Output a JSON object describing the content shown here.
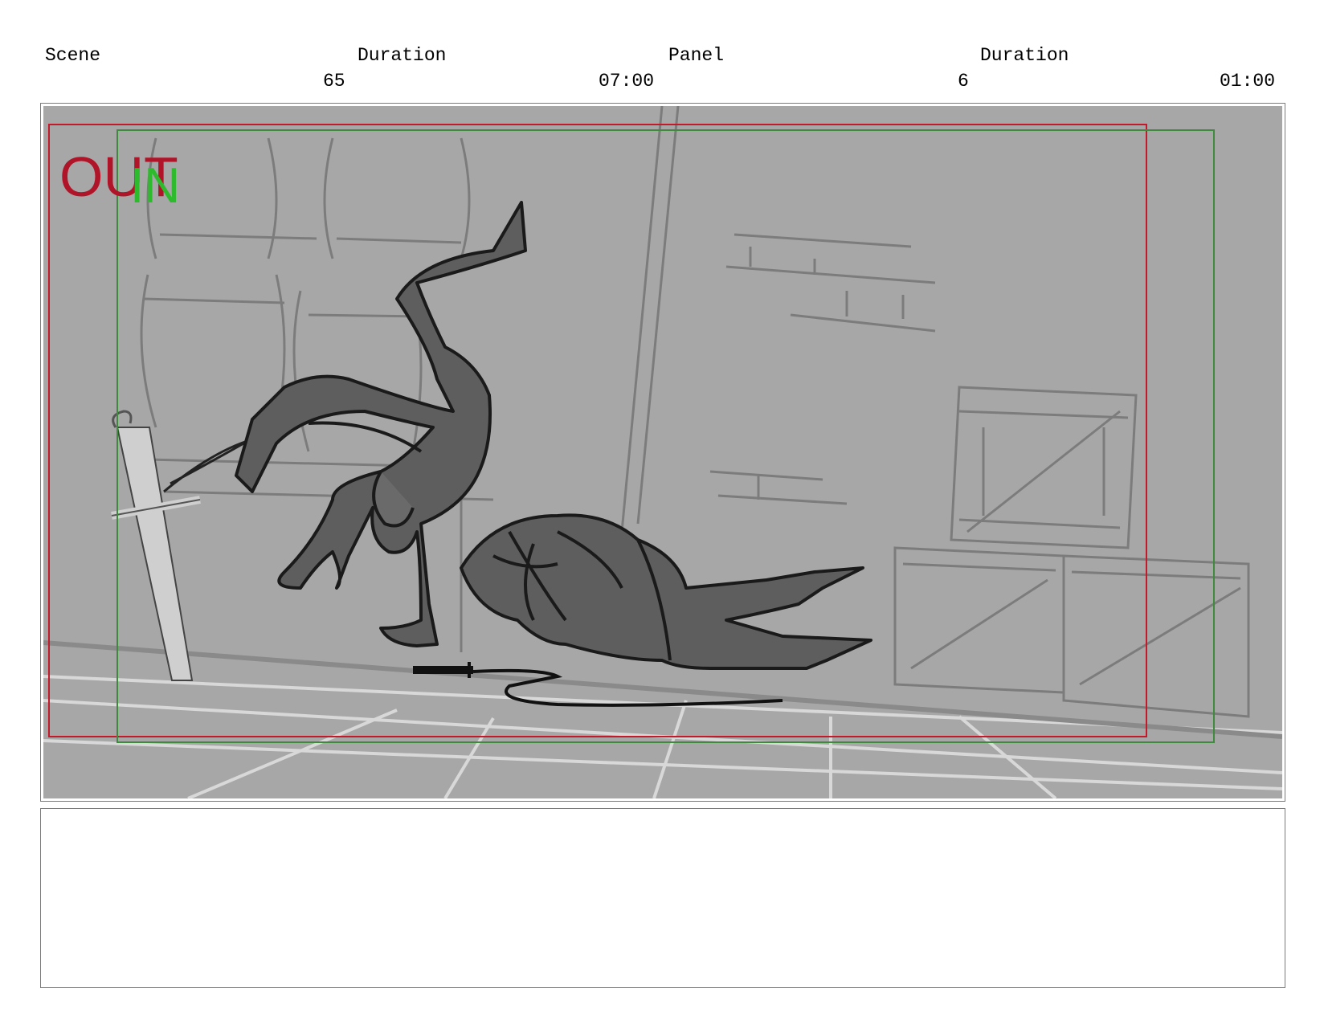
{
  "header": {
    "scene_label": "Scene",
    "scene_duration_label": "Duration",
    "panel_label": "Panel",
    "panel_duration_label": "Duration",
    "scene_number": "65",
    "scene_duration": "07:00",
    "panel_number": "6",
    "panel_duration": "01:00"
  },
  "frame": {
    "out_marker": "OUT",
    "in_marker": "IN",
    "colors": {
      "background": "#a7a7a7",
      "out_guide": "#c21a2a",
      "in_guide": "#3f8a3f",
      "figure_fill": "#5e5e5e",
      "figure_line": "#1a1a1a",
      "set_line": "#7c7c7c",
      "floor_line": "#d8d8d8"
    }
  },
  "notes": {
    "text": ""
  }
}
